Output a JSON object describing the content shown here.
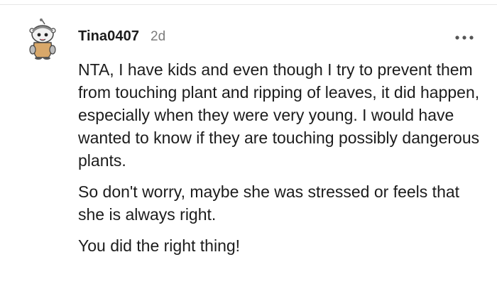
{
  "comment": {
    "username": "Tina0407",
    "timestamp": "2d",
    "more_icon": "ellipsis-icon",
    "avatar_icon": "snoo-avatar-icon",
    "paragraphs": [
      "NTA, I have kids and even though I try to prevent them from touching plant and ripping of leaves, it did happen, especially when they were very young. I would have wanted to know if they are touching possibly dangerous plants.",
      "So don't worry, maybe she was stressed or feels that she is always right.",
      "You did the right thing!"
    ]
  },
  "colors": {
    "text": "#1c1c1c",
    "meta": "#7c7c7c",
    "divider": "#e6e6e6",
    "background": "#ffffff"
  }
}
